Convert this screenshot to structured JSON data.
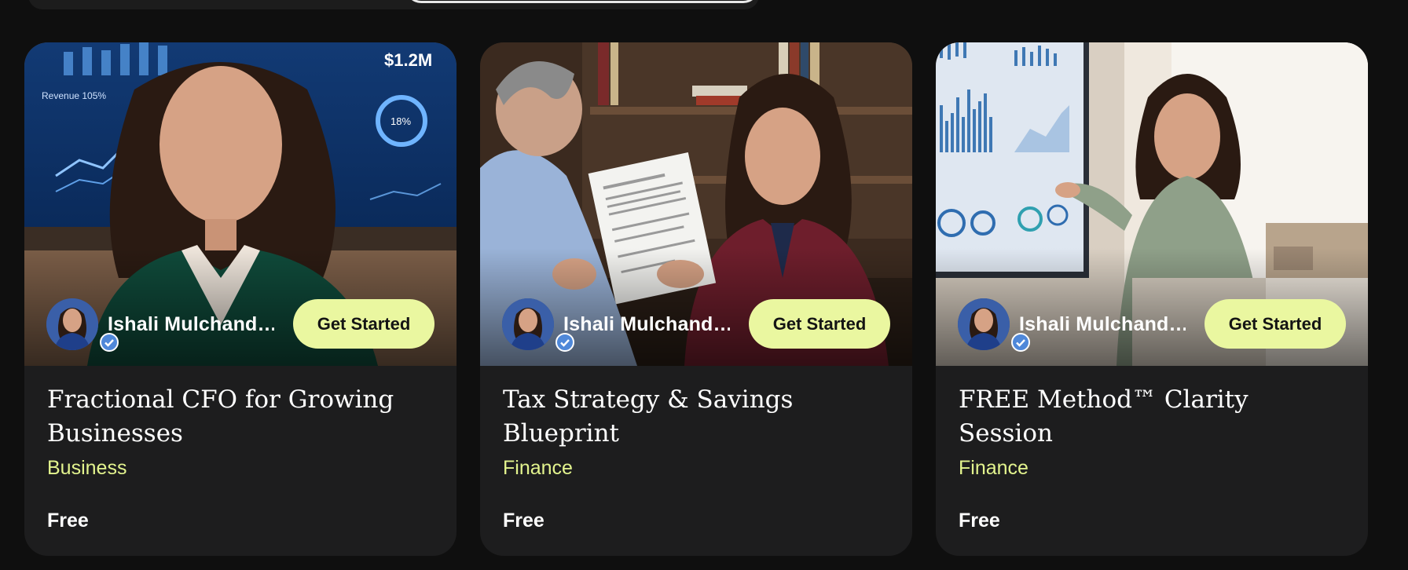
{
  "cards": [
    {
      "host_name": "Ishali Mulchand…",
      "cta_label": "Get Started",
      "title": "Fractional CFO for Growing Businesses",
      "category": "Business",
      "price": "Free",
      "image_text": {
        "amount": "$1.2M",
        "panel_label": "Revenue 105%",
        "percent": "18%"
      }
    },
    {
      "host_name": "Ishali Mulchand…",
      "cta_label": "Get Started",
      "title": "Tax Strategy & Savings Blueprint",
      "category": "Finance",
      "price": "Free"
    },
    {
      "host_name": "Ishali Mulchand…",
      "cta_label": "Get Started",
      "title": "FREE Method™ Clarity Session",
      "category": "Finance",
      "price": "Free"
    }
  ],
  "icons": {
    "verified": "check-badge-icon"
  },
  "colors": {
    "accent": "#eaf7a0",
    "category": "#e3f48e",
    "card_bg": "#1d1d1e",
    "page_bg": "#0f0f0f",
    "badge": "#4f88d9"
  }
}
